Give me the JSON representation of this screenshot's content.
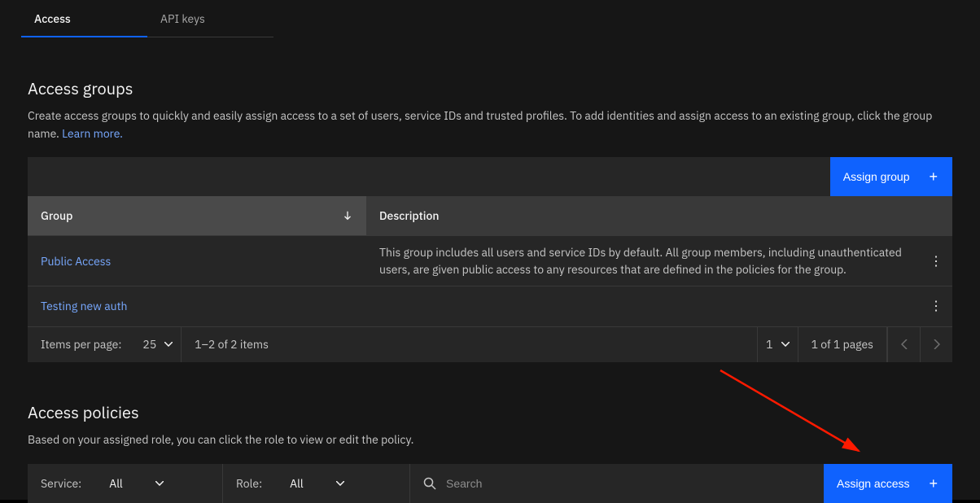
{
  "tabs": [
    {
      "label": "Access",
      "active": true
    },
    {
      "label": "API keys",
      "active": false
    }
  ],
  "access_groups": {
    "title": "Access groups",
    "description": "Create access groups to quickly and easily assign access to a set of users, service IDs and trusted profiles. To add identities and assign access to an existing group, click the group name. ",
    "learn_more": "Learn more.",
    "assign_group_btn": "Assign group",
    "columns": {
      "group": "Group",
      "description": "Description"
    },
    "rows": [
      {
        "name": "Public Access",
        "description": "This group includes all users and service IDs by default. All group members, including unauthenticated users, are given public access to any resources that are defined in the policies for the group."
      },
      {
        "name": "Testing new auth",
        "description": ""
      }
    ],
    "pagination": {
      "items_per_page_label": "Items per page:",
      "items_per_page_value": "25",
      "range": "1–2 of 2 items",
      "page_select": "1",
      "pages_text": "1 of 1 pages"
    }
  },
  "access_policies": {
    "title": "Access policies",
    "description": "Based on your assigned role, you can click the role to view or edit the policy.",
    "filters": {
      "service_label": "Service:",
      "service_value": "All",
      "role_label": "Role:",
      "role_value": "All"
    },
    "search_placeholder": "Search",
    "assign_access_btn": "Assign access"
  }
}
